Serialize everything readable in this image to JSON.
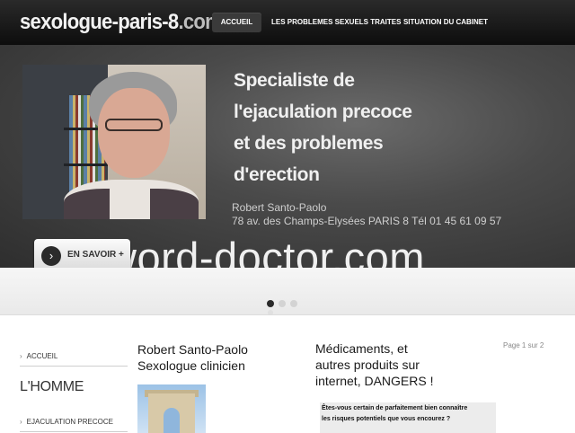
{
  "header": {
    "logo_main": "sexologue-paris-8",
    "logo_tld": ".com",
    "nav": [
      {
        "label": "ACCUEIL",
        "active": true
      },
      {
        "label": "LES PROBLEMES SEXUELS TRAITES",
        "active": false
      },
      {
        "label": "SITUATION DU CABINET",
        "active": false
      }
    ]
  },
  "hero": {
    "headline": [
      "Specialiste de",
      "l'ejaculation precoce",
      "et des problemes",
      "d'erection"
    ],
    "address": [
      "Robert Santo-Paolo",
      "78 av. des Champs-Elysées PARIS 8 Tél 01 45 61 09 57"
    ],
    "watermark": "word-doctor.com",
    "cta_icon": "arrow-right-circle-icon",
    "cta_label": "EN SAVOIR +",
    "active_slide": 1,
    "slide_count": 3
  },
  "sidebar": {
    "items": [
      {
        "label": "ACCUEIL"
      },
      {
        "label": "EJACULATION PRECOCE"
      }
    ],
    "heading": "L'HOMME",
    "chevron_icon": "chevron-right-icon"
  },
  "intro": {
    "name": "Robert Santo-Paolo",
    "title": "Sexologue clinicien",
    "image_icon": "arc-de-triomphe-photo"
  },
  "article": {
    "title_lines": [
      "Médicaments, et",
      "autres produits sur",
      "internet, DANGERS !"
    ],
    "pagination": "Page 1 sur 2",
    "question_lines": [
      "Êtes-vous certain de parfaitement bien connaître",
      "les risques potentiels que vous encourez ?"
    ]
  },
  "colors": {
    "header_bg": "#141414",
    "hero_bg": "#4a4a4a",
    "text_dark": "#1a1a1a"
  }
}
